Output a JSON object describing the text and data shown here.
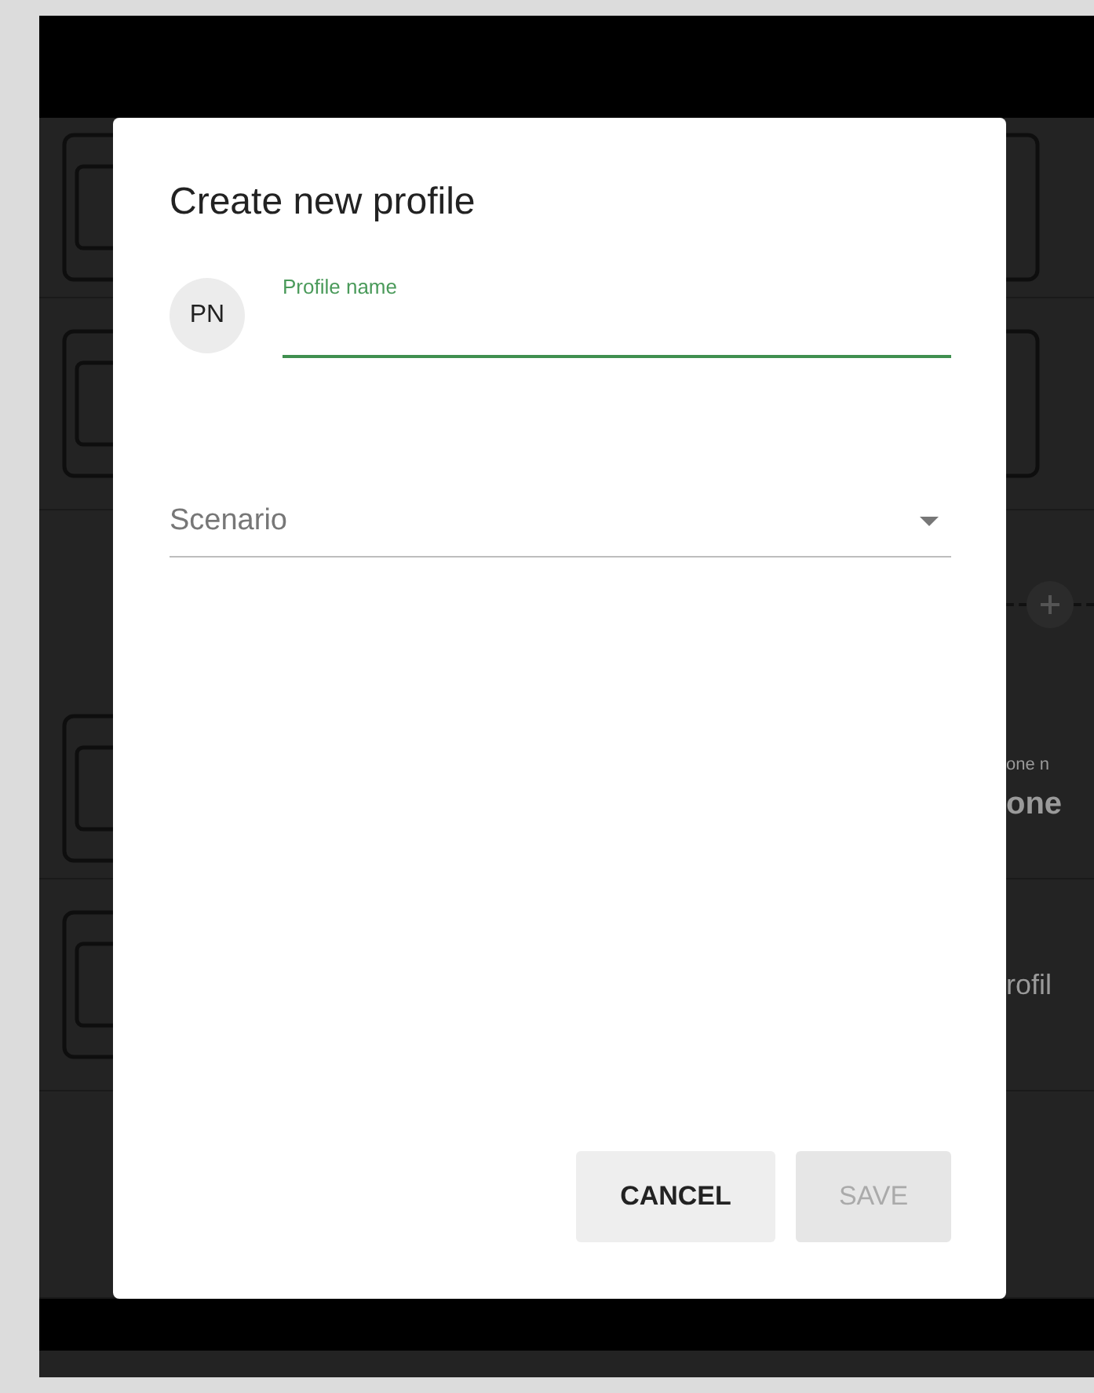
{
  "dialog": {
    "title": "Create new profile",
    "avatar": "PN",
    "profile_name": {
      "label": "Profile name",
      "focused": true
    },
    "scenario": {
      "placeholder": "Scenario"
    },
    "buttons": [
      {
        "label": "CANCEL",
        "disabled": false
      },
      {
        "label": "SAVE",
        "disabled": true
      }
    ]
  },
  "background": {
    "zone_caption": "one n",
    "zone_value": "one",
    "profile_label": "rofil"
  }
}
